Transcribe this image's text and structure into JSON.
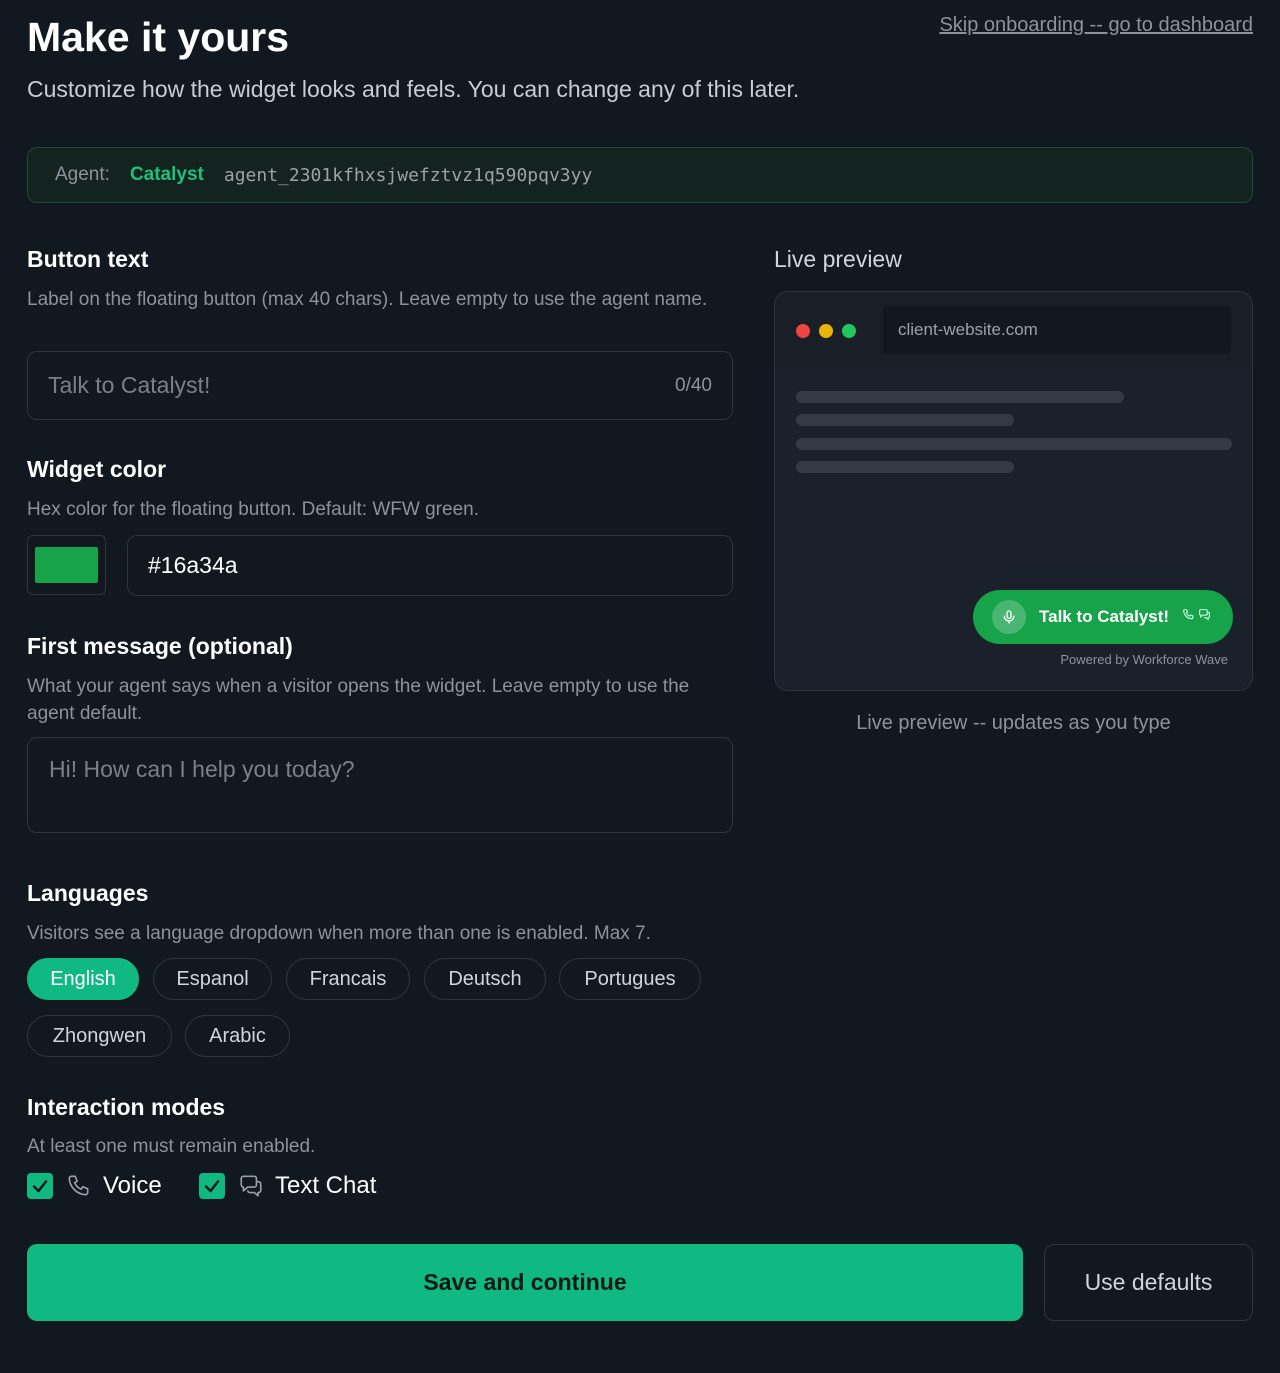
{
  "header": {
    "title": "Make it yours",
    "subtitle": "Customize how the widget looks and feels. You can change any of this later.",
    "skip_link": "Skip onboarding -- go to dashboard"
  },
  "agent": {
    "label": "Agent:",
    "name": "Catalyst",
    "id": "agent_2301kfhxsjwefztvz1q590pqv3yy"
  },
  "button_text": {
    "title": "Button text",
    "description": "Label on the floating button (max 40 chars). Leave empty to use the agent name.",
    "placeholder": "Talk to Catalyst!",
    "counter": "0/40"
  },
  "widget_color": {
    "title": "Widget color",
    "description": "Hex color for the floating button. Default: WFW green.",
    "value": "#16a34a",
    "swatch_color": "#16a34a"
  },
  "first_message": {
    "title": "First message (optional)",
    "description": "What your agent says when a visitor opens the widget. Leave empty to use the agent default.",
    "placeholder": "Hi! How can I help you today?"
  },
  "languages": {
    "title": "Languages",
    "description": "Visitors see a language dropdown when more than one is enabled. Max 7.",
    "options": [
      {
        "label": "English",
        "selected": true
      },
      {
        "label": "Espanol",
        "selected": false
      },
      {
        "label": "Francais",
        "selected": false
      },
      {
        "label": "Deutsch",
        "selected": false
      },
      {
        "label": "Portugues",
        "selected": false
      },
      {
        "label": "Zhongwen",
        "selected": false
      },
      {
        "label": "Arabic",
        "selected": false
      }
    ]
  },
  "interaction_modes": {
    "title": "Interaction modes",
    "description": "At least one must remain enabled.",
    "voice": {
      "label": "Voice",
      "checked": true,
      "icon": "phone-icon"
    },
    "text_chat": {
      "label": "Text Chat",
      "checked": true,
      "icon": "chat-icon"
    }
  },
  "actions": {
    "save": "Save and continue",
    "defaults": "Use defaults"
  },
  "preview": {
    "title": "Live preview",
    "url": "client-website.com",
    "widget_label": "Talk to Catalyst!",
    "powered_by": "Powered by Workforce Wave",
    "caption": "Live preview -- updates as you type"
  },
  "colors": {
    "accent": "#10b981",
    "widget_green": "#16a34a",
    "background": "#111820",
    "dot_red": "#ef4444",
    "dot_yellow": "#eab308",
    "dot_green": "#22c55e"
  }
}
